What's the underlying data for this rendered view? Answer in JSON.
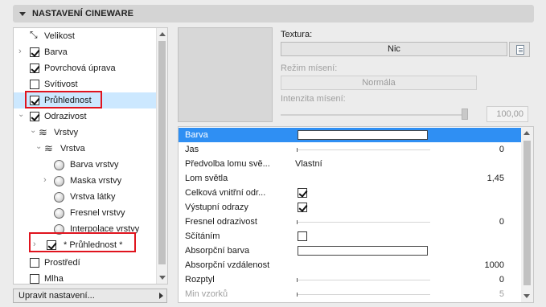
{
  "header": {
    "title": "NASTAVENÍ CINEWARE"
  },
  "tree": {
    "items": [
      {
        "label": "Velikost",
        "checkbox": null,
        "expandable": false
      },
      {
        "label": "Barva",
        "checkbox": true,
        "expandable": true
      },
      {
        "label": "Povrchová úprava",
        "checkbox": true,
        "expandable": false
      },
      {
        "label": "Svítivost",
        "checkbox": false,
        "expandable": false
      },
      {
        "label": "Průhlednost",
        "checkbox": true,
        "expandable": false,
        "selected": true
      },
      {
        "label": "Odrazivost",
        "checkbox": true,
        "expandable": true,
        "expanded": true
      },
      {
        "label": "Vrstvy",
        "checkbox": null,
        "expandable": true,
        "expanded": true
      },
      {
        "label": "Vrstva",
        "checkbox": null,
        "expandable": true,
        "expanded": true
      },
      {
        "label": "Barva vrstvy"
      },
      {
        "label": "Maska vrstvy"
      },
      {
        "label": "Vrstva látky"
      },
      {
        "label": "Fresnel vrstvy"
      },
      {
        "label": "Interpolace vrstvy"
      },
      {
        "label": "* Průhlednost *",
        "checkbox": true,
        "expandable": true
      },
      {
        "label": "Prostředí",
        "checkbox": false
      },
      {
        "label": "Mlha",
        "checkbox": false
      }
    ]
  },
  "bottom_button": {
    "label": "Upravit nastavení..."
  },
  "texture": {
    "label": "Textura:",
    "value": "Nic",
    "blend_mode_label": "Režim mísení:",
    "blend_mode_value": "Normála",
    "blend_intensity_label": "Intenzita mísení:",
    "blend_intensity_value": "100,00",
    "blend_intensity_level": 1.0
  },
  "properties": [
    {
      "name": "Barva",
      "kind": "color",
      "selected": true
    },
    {
      "name": "Jas",
      "kind": "slider",
      "value": "0"
    },
    {
      "name": "Předvolba lomu svě...",
      "kind": "text",
      "value": "Vlastní"
    },
    {
      "name": "Lom světla",
      "kind": "number",
      "value": "1,45"
    },
    {
      "name": "Celková vnitřní odr...",
      "kind": "checkbox",
      "checked": true
    },
    {
      "name": "Výstupní odrazy",
      "kind": "checkbox",
      "checked": true
    },
    {
      "name": "Fresnel odrazivost",
      "kind": "slider",
      "value": "0"
    },
    {
      "name": "Sčítáním",
      "kind": "checkbox",
      "checked": false
    },
    {
      "name": "Absorpční barva",
      "kind": "color"
    },
    {
      "name": "Absorpční vzdálenost",
      "kind": "number",
      "value": "1000"
    },
    {
      "name": "Rozptyl",
      "kind": "slider",
      "value": "0"
    },
    {
      "name": "Min vzorků",
      "kind": "slider",
      "value": "5",
      "dim": true
    }
  ],
  "colors": {
    "selection": "#2f8ff3",
    "tree_selection": "#cce8ff",
    "highlight_box": "#e0141e"
  }
}
